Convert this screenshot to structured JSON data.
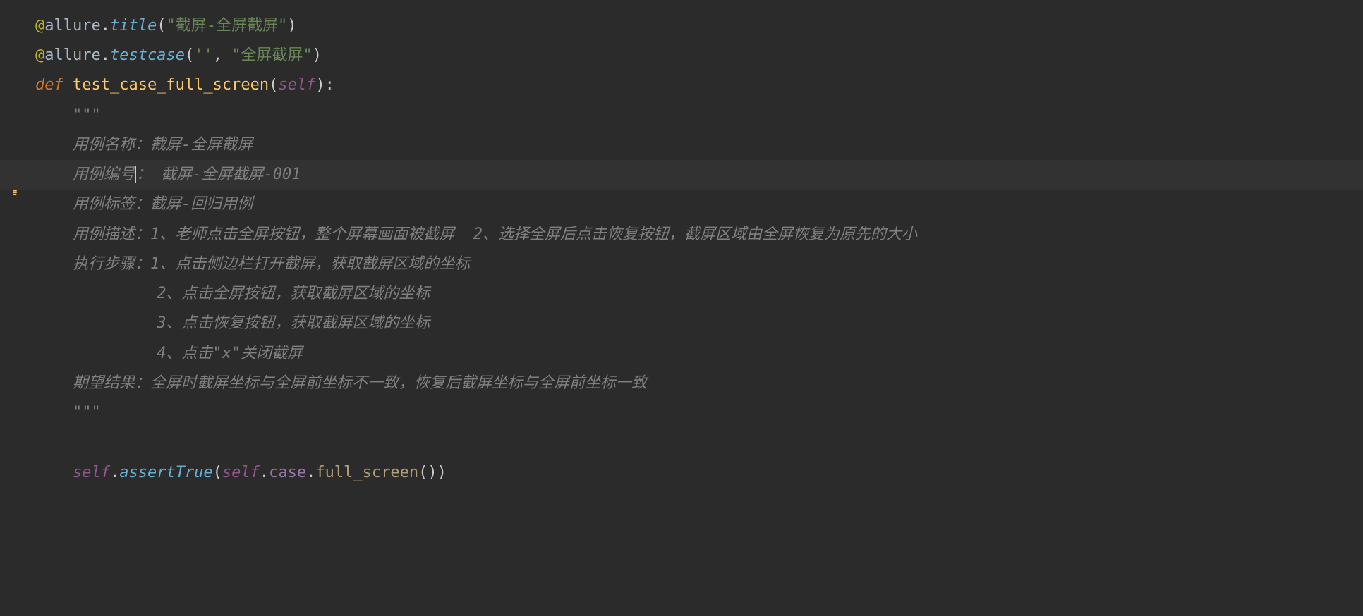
{
  "code": {
    "line1": {
      "at": "@",
      "allure": "allure",
      "dot": ".",
      "title": "title",
      "lparen": "(",
      "str": "\"截屏-全屏截屏\"",
      "rparen": ")"
    },
    "line2": {
      "at": "@",
      "allure": "allure",
      "dot": ".",
      "testcase": "testcase",
      "lparen": "(",
      "str1": "''",
      "comma": ", ",
      "str2": "\"全屏截屏\"",
      "rparen": ")"
    },
    "line3": {
      "def": "def ",
      "name": "test_case_full_screen",
      "lparen": "(",
      "self": "self",
      "rparen": "):"
    },
    "line4": {
      "triple": "\"\"\""
    },
    "line5": {
      "text": "用例名称：截屏-全屏截屏"
    },
    "line6": {
      "label": "用例编号",
      "colon": "：",
      "rest": " 截屏-全屏截屏-001"
    },
    "line7": {
      "text": "用例标签：截屏-回归用例"
    },
    "line8": {
      "text": "用例描述：1、老师点击全屏按钮，整个屏幕画面被截屏  2、选择全屏后点击恢复按钮，截屏区域由全屏恢复为原先的大小"
    },
    "line9": {
      "text": "执行步骤：1、点击侧边栏打开截屏，获取截屏区域的坐标"
    },
    "line10": {
      "text": "         2、点击全屏按钮，获取截屏区域的坐标"
    },
    "line11": {
      "text": "         3、点击恢复按钮，获取截屏区域的坐标"
    },
    "line12": {
      "text": "         4、点击\"x\"关闭截屏"
    },
    "line13": {
      "text": "期望结果：全屏时截屏坐标与全屏前坐标不一致，恢复后截屏坐标与全屏前坐标一致"
    },
    "line14": {
      "triple": "\"\"\""
    },
    "line15": {
      "self": "self",
      "dot": ".",
      "assertTrue": "assertTrue",
      "lparen": "(",
      "self2": "self",
      "dot2": ".",
      "case": "case",
      "dot3": ".",
      "full_screen": "full_screen",
      "call": "())"
    }
  }
}
